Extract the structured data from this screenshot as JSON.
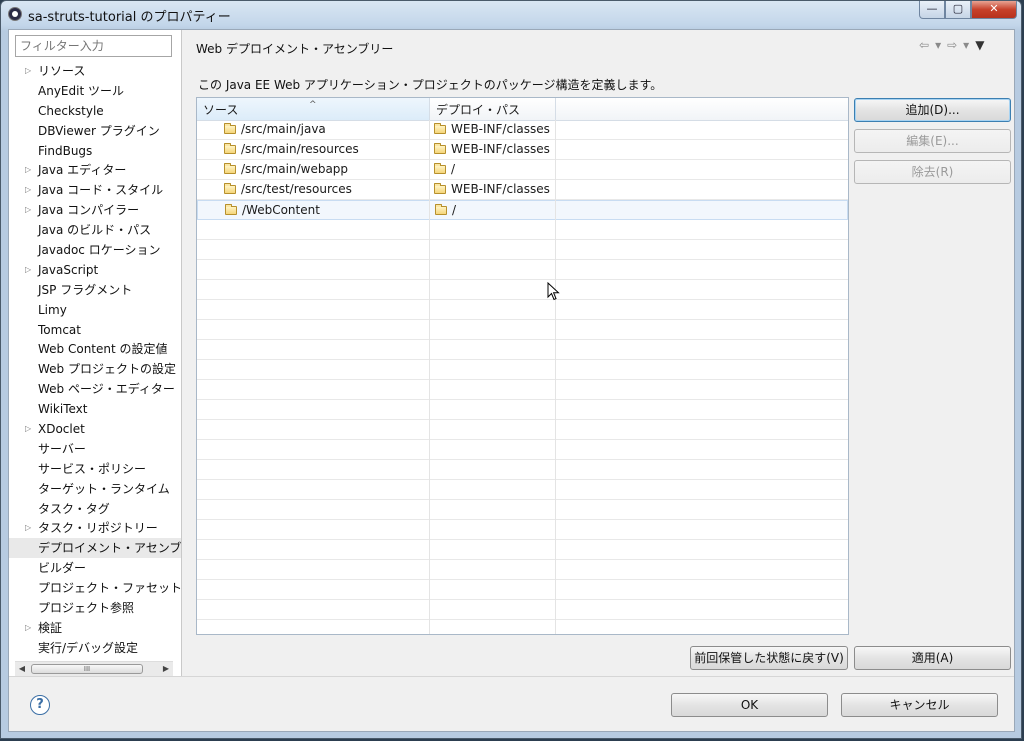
{
  "window": {
    "title": "sa-struts-tutorial のプロパティー",
    "controls": {
      "minimize": "—",
      "maximize": "▢",
      "close": "✕"
    }
  },
  "filter": {
    "placeholder": "フィルター入力"
  },
  "tree": {
    "items": [
      {
        "label": "リソース",
        "expandable": true
      },
      {
        "label": "AnyEdit ツール",
        "expandable": false
      },
      {
        "label": "Checkstyle",
        "expandable": false
      },
      {
        "label": "DBViewer プラグイン",
        "expandable": false
      },
      {
        "label": "FindBugs",
        "expandable": false
      },
      {
        "label": "Java エディター",
        "expandable": true
      },
      {
        "label": "Java コード・スタイル",
        "expandable": true
      },
      {
        "label": "Java コンパイラー",
        "expandable": true
      },
      {
        "label": "Java のビルド・パス",
        "expandable": false
      },
      {
        "label": "Javadoc ロケーション",
        "expandable": false
      },
      {
        "label": "JavaScript",
        "expandable": true
      },
      {
        "label": "JSP フラグメント",
        "expandable": false
      },
      {
        "label": "Limy",
        "expandable": false
      },
      {
        "label": "Tomcat",
        "expandable": false
      },
      {
        "label": "Web Content の設定値",
        "expandable": false
      },
      {
        "label": "Web プロジェクトの設定",
        "expandable": false
      },
      {
        "label": "Web ページ・エディター",
        "expandable": false
      },
      {
        "label": "WikiText",
        "expandable": false
      },
      {
        "label": "XDoclet",
        "expandable": true
      },
      {
        "label": "サーバー",
        "expandable": false
      },
      {
        "label": "サービス・ポリシー",
        "expandable": false
      },
      {
        "label": "ターゲット・ランタイム",
        "expandable": false
      },
      {
        "label": "タスク・タグ",
        "expandable": false
      },
      {
        "label": "タスク・リポジトリー",
        "expandable": true
      },
      {
        "label": "デプロイメント・アセンブ",
        "expandable": false,
        "selected": true
      },
      {
        "label": "ビルダー",
        "expandable": false
      },
      {
        "label": "プロジェクト・ファセット",
        "expandable": false
      },
      {
        "label": "プロジェクト参照",
        "expandable": false
      },
      {
        "label": "検証",
        "expandable": true
      },
      {
        "label": "実行/デバッグ設定",
        "expandable": false
      }
    ],
    "scroll_thumb_grip": "III"
  },
  "page": {
    "title": "Web デプロイメント・アセンブリー",
    "description": "この Java EE Web アプリケーション・プロジェクトのパッケージ構造を定義します。",
    "nav": {
      "back": "⇦",
      "back_menu": "▾",
      "forward": "⇨",
      "forward_menu": "▾",
      "view_menu": "▼"
    }
  },
  "table": {
    "columns": [
      "ソース",
      "デプロイ・パス",
      ""
    ],
    "rows": [
      {
        "source": "/src/main/java",
        "deploy_path": "WEB-INF/classes"
      },
      {
        "source": "/src/main/resources",
        "deploy_path": "WEB-INF/classes"
      },
      {
        "source": "/src/main/webapp",
        "deploy_path": "/"
      },
      {
        "source": "/src/test/resources",
        "deploy_path": "WEB-INF/classes"
      },
      {
        "source": "/WebContent",
        "deploy_path": "/",
        "selected": true
      }
    ],
    "empty_rows": 21
  },
  "buttons": {
    "add": "追加(D)...",
    "edit": "編集(E)...",
    "remove": "除去(R)",
    "revert": "前回保管した状態に戻す(V)",
    "apply": "適用(A)",
    "ok": "OK",
    "cancel": "キャンセル",
    "help": "?"
  }
}
